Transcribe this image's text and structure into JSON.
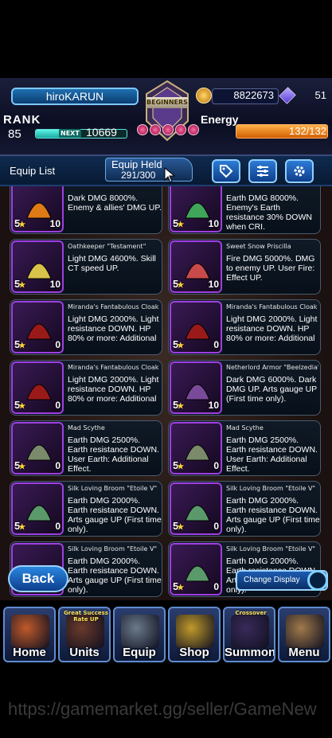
{
  "player": {
    "name": "hiroKARUN",
    "rank_label": "RANK",
    "rank_value": "85",
    "next_label": "NEXT",
    "next_value": "10669",
    "exp_fraction": 0.35,
    "emblem_text": "BEGINNERS",
    "coins": "8822673",
    "gems": "51",
    "energy_label": "Energy",
    "energy_value": "132/132",
    "energy_fraction": 1.0
  },
  "list_bar": {
    "title": "Equip List",
    "held_label": "Equip Held",
    "held_value": "291/300",
    "buttons": [
      "tag-icon",
      "filter-icon",
      "gear-icon"
    ]
  },
  "items": [
    {
      "name": "",
      "desc": "Dark DMG 8000%. Enemy & allies' DMG UP.",
      "stars": "5",
      "lv": "10",
      "art": "#e07a16"
    },
    {
      "name": "",
      "desc": "Earth DMG 8000%. Enemy's Earth resistance 30% DOWN when CRI.",
      "stars": "5",
      "lv": "10",
      "art": "#3fa55a"
    },
    {
      "name": "Oathkeeper \"Testament\"",
      "desc": "Light DMG 4600%. Skill CT speed UP.",
      "stars": "5",
      "lv": "10",
      "art": "#d9c24a"
    },
    {
      "name": "Sweet Snow Priscilla",
      "desc": "Fire DMG 5000%. DMG to enemy UP. User Fire: Effect UP.",
      "stars": "5",
      "lv": "10",
      "art": "#c84a4a"
    },
    {
      "name": "Miranda's Fantabulous Cloak",
      "desc": "Light DMG 2000%. Light resistance DOWN. HP 80% or more: Additional",
      "stars": "5",
      "lv": "0",
      "art": "#9a1a1a"
    },
    {
      "name": "Miranda's Fantabulous Cloak",
      "desc": "Light DMG 2000%. Light resistance DOWN. HP 80% or more: Additional",
      "stars": "5",
      "lv": "0",
      "art": "#9a1a1a"
    },
    {
      "name": "Miranda's Fantabulous Cloak",
      "desc": "Light DMG 2000%. Light resistance DOWN. HP 80% or more: Additional",
      "stars": "5",
      "lv": "0",
      "art": "#9a1a1a"
    },
    {
      "name": "Netherlord Armor \"Beelzedia\"",
      "desc": "Dark DMG 6000%. Dark DMG UP. Arts gauge UP (First time only).",
      "stars": "5",
      "lv": "10",
      "art": "#7a4a9a"
    },
    {
      "name": "Mad Scythe",
      "desc": "Earth DMG 2500%. Earth resistance DOWN. User Earth: Additional Effect.",
      "stars": "5",
      "lv": "0",
      "art": "#7a8a6a"
    },
    {
      "name": "Mad Scythe",
      "desc": "Earth DMG 2500%. Earth resistance DOWN. User Earth: Additional Effect.",
      "stars": "5",
      "lv": "0",
      "art": "#7a8a6a"
    },
    {
      "name": "Silk Loving Broom \"Etoile V\"",
      "desc": "Earth DMG 2000%. Earth resistance DOWN. Arts gauge UP (First time only).",
      "stars": "5",
      "lv": "0",
      "art": "#5a9a6a"
    },
    {
      "name": "Silk Loving Broom \"Etoile V\"",
      "desc": "Earth DMG 2000%. Earth resistance DOWN. Arts gauge UP (First time only).",
      "stars": "5",
      "lv": "0",
      "art": "#5a9a6a"
    },
    {
      "name": "Silk Loving Broom \"Etoile V\"",
      "desc": "Earth DMG 2000%. Earth resistance DOWN. Arts gauge UP (First time only).",
      "stars": "5",
      "lv": "0",
      "art": "#5a9a6a"
    },
    {
      "name": "Silk Loving Broom \"Etoile V\"",
      "desc": "Earth DMG 2000%. Earth resistance DOWN. Arts gauge UP (First time only).",
      "stars": "5",
      "lv": "0",
      "art": "#5a9a6a"
    }
  ],
  "controls": {
    "back_label": "Back",
    "change_display_label": "Change Display"
  },
  "nav": [
    {
      "label": "Home",
      "badge": "",
      "art": "#c05a2a"
    },
    {
      "label": "Units",
      "badge": "Great Success Rate UP",
      "art": "#6a3a2a"
    },
    {
      "label": "Equip",
      "badge": "",
      "art": "#6a7a8a"
    },
    {
      "label": "Shop",
      "badge": "",
      "art": "#c09a2a"
    },
    {
      "label": "Summon",
      "badge": "Crossover",
      "art": "#3a2a5a"
    },
    {
      "label": "Menu",
      "badge": "",
      "art": "#a07a4a"
    }
  ],
  "watermark": "https://gamemarket.gg/seller/GameNew"
}
